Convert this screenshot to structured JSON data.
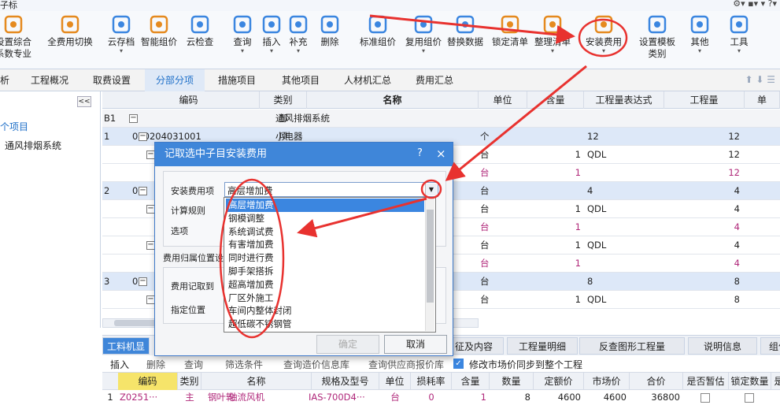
{
  "title_fragment": "子标",
  "toolbar": {
    "items": [
      {
        "label": "设置综合\n系数专业",
        "icon": "settings-icon"
      },
      {
        "label": "全费用切换",
        "icon": "switch-icon"
      },
      {
        "label": "云存档",
        "icon": "cloud-upload-icon",
        "dropdown": true
      },
      {
        "label": "智能组价",
        "icon": "smart-price-icon"
      },
      {
        "label": "云检查",
        "icon": "cloud-check-icon"
      },
      {
        "label": "查询",
        "icon": "query-icon",
        "dropdown": true
      },
      {
        "label": "插入",
        "icon": "insert-icon",
        "dropdown": true
      },
      {
        "label": "补充",
        "icon": "supplement-icon",
        "dropdown": true
      },
      {
        "label": "删除",
        "icon": "delete-icon"
      },
      {
        "label": "标准组价",
        "icon": "standard-price-icon"
      },
      {
        "label": "复用组价",
        "icon": "reuse-price-icon",
        "dropdown": true
      },
      {
        "label": "替换数据",
        "icon": "replace-icon"
      },
      {
        "label": "锁定清单",
        "icon": "lock-icon"
      },
      {
        "label": "整理清单",
        "icon": "organize-icon",
        "dropdown": true
      },
      {
        "label": "安装费用",
        "icon": "install-fee-icon",
        "dropdown": true
      },
      {
        "label": "设置模板\n类别",
        "icon": "template-icon"
      },
      {
        "label": "其他",
        "icon": "other-icon",
        "dropdown": true
      },
      {
        "label": "工具",
        "icon": "tools-icon",
        "dropdown": true
      }
    ]
  },
  "tabs": [
    "析",
    "工程概况",
    "取费设置",
    "分部分项",
    "措施项目",
    "其他项目",
    "人材机汇总",
    "费用汇总"
  ],
  "active_tab": "分部分项",
  "left_tree": {
    "collapse_symbol": "<<",
    "root": "个项目",
    "child": "通风排烟系统"
  },
  "grid": {
    "headers": [
      "编码",
      "类别",
      "名称",
      "单位",
      "含量",
      "工程量表达式",
      "工程量",
      "单"
    ],
    "rows": [
      {
        "idx": "B1",
        "code": "",
        "type": "部",
        "name": "通风排烟系统",
        "unit": "",
        "qty_content": "",
        "expr": "",
        "qty": "",
        "style": "section"
      },
      {
        "idx": "1",
        "code": "030204031001",
        "type": "项",
        "name": "小电器",
        "unit": "个",
        "qty_content": "",
        "expr": "12",
        "qty": "12",
        "style": "blue"
      },
      {
        "idx": "",
        "code": "",
        "type": "",
        "name": "",
        "unit": "台",
        "qty_content": "1",
        "expr": "QDL",
        "qty": "12",
        "style": "normal"
      },
      {
        "idx": "",
        "code": "",
        "type": "",
        "name": "",
        "unit": "台",
        "qty_content": "1",
        "expr": "",
        "qty": "12",
        "style": "pink"
      },
      {
        "idx": "2",
        "code": "0",
        "type": "",
        "name": "",
        "unit": "台",
        "qty_content": "",
        "expr": "4",
        "qty": "4",
        "style": "blue"
      },
      {
        "idx": "",
        "code": "",
        "type": "",
        "name": "",
        "unit": "台",
        "qty_content": "1",
        "expr": "QDL",
        "qty": "4",
        "style": "normal"
      },
      {
        "idx": "",
        "code": "",
        "type": "",
        "name": "",
        "unit": "台",
        "qty_content": "1",
        "expr": "",
        "qty": "4",
        "style": "pink"
      },
      {
        "idx": "",
        "code": "",
        "type": "",
        "name": "",
        "unit": "台",
        "qty_content": "1",
        "expr": "QDL",
        "qty": "4",
        "style": "normal"
      },
      {
        "idx": "",
        "code": "",
        "type": "",
        "name": "",
        "unit": "台",
        "qty_content": "1",
        "expr": "",
        "qty": "4",
        "style": "pink"
      },
      {
        "idx": "3",
        "code": "0",
        "type": "",
        "name": "",
        "unit": "台",
        "qty_content": "",
        "expr": "8",
        "qty": "8",
        "style": "blue"
      },
      {
        "idx": "",
        "code": "",
        "type": "",
        "name": "",
        "unit": "台",
        "qty_content": "1",
        "expr": "QDL",
        "qty": "8",
        "style": "normal"
      }
    ]
  },
  "dialog": {
    "title": "记取选中子目安装费用",
    "help": "?",
    "close": "×",
    "labels": {
      "fee_item": "安装费用项",
      "calc_rule": "计算规则",
      "option": "选项",
      "fee_position": "费用归属位置设",
      "fee_to": "费用记取到",
      "assign_position": "指定位置"
    },
    "selected_value": "高层增加费",
    "ok": "确定",
    "cancel": "取消"
  },
  "dropdown_options": [
    "高层增加费",
    "钢模调整",
    "系统调试费",
    "有害增加费",
    "同时进行费",
    "脚手架搭拆",
    "超高增加费",
    "厂区外施工",
    "车间内整体封闭",
    "超低碳不锈钢管"
  ],
  "bottom_tabs": [
    "工料机显",
    "征及内容",
    "工程量明细",
    "反查图形工程量",
    "说明信息",
    "组价方案"
  ],
  "bottom_toolbar": {
    "insert": "插入",
    "delete": "删除",
    "query": "查询",
    "filter": "筛选条件",
    "query_price": "查询造价信息库",
    "query_supplier": "查询供应商报价库",
    "sync_label": "修改市场价同步到整个工程"
  },
  "bottom_headers": [
    "编码",
    "类别",
    "名称",
    "规格及型号",
    "单位",
    "损耗率",
    "含量",
    "数量",
    "定额价",
    "市场价",
    "合价",
    "是否暂估",
    "锁定数量",
    "是"
  ],
  "bottom_row": {
    "idx": "1",
    "code": "Z0251···",
    "type": "主",
    "name": "轴流风机",
    "name_prefix": "钢叶轮",
    "spec": "IAS-700D4···",
    "unit": "台",
    "loss": "0",
    "content": "1",
    "qty": "8",
    "quota": "4600",
    "market": "4600",
    "total": "36800"
  },
  "colors": {
    "accent": "#3f86d9",
    "annotation": "#e8322f",
    "selected": "#3b86e0",
    "pink": "#b0287a"
  }
}
